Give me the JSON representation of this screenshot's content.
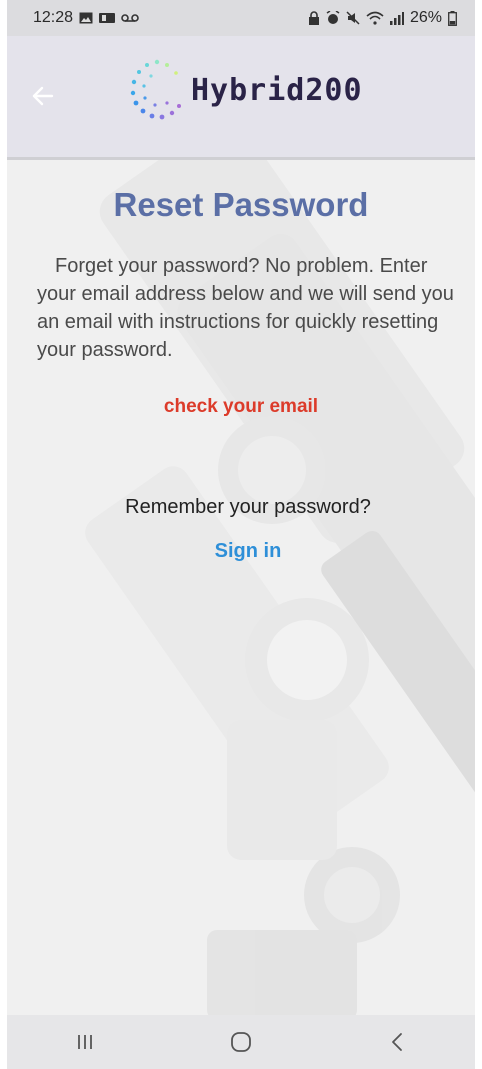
{
  "status_bar": {
    "time": "12:28",
    "battery": "26%",
    "left_icons": [
      "gallery-icon",
      "sim-icon",
      "voicemail-icon"
    ],
    "right_icons": [
      "lock-icon",
      "alarm-icon",
      "mute-icon",
      "wifi-icon",
      "signal-icon",
      "battery-icon"
    ]
  },
  "app_bar": {
    "logo_text": "Hybrid200",
    "back_icon": "arrow-left-icon"
  },
  "page": {
    "title": "Reset Password",
    "description": "Forget your password? No problem. Enter your email address below and we will send you an email with instructions for quickly resetting your password.",
    "notice": "check your email",
    "remember_text": "Remember your password?",
    "signin_link": "Sign in"
  },
  "colors": {
    "title": "#5b6fa6",
    "notice": "#dc3b2a",
    "link": "#2e8fd8",
    "app_bar": "#e4e3eb"
  },
  "nav_bar": {
    "items": [
      "recents-icon",
      "home-icon",
      "back-icon"
    ]
  }
}
